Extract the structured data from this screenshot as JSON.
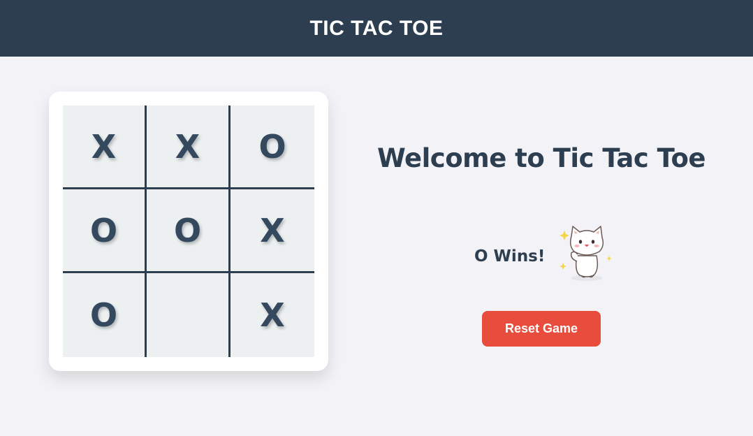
{
  "header": {
    "title": "TIC TAC TOE"
  },
  "board": {
    "cells": [
      "X",
      "X",
      "O",
      "O",
      "O",
      "X",
      "O",
      "",
      "X"
    ]
  },
  "main": {
    "welcome": "Welcome to Tic Tac Toe",
    "status": "O Wins!",
    "status_image": "happy-cat-sticker",
    "reset_label": "Reset Game"
  },
  "colors": {
    "header_bg": "#2d3e50",
    "page_bg": "#f3f3f7",
    "board_bg": "#ecf0f1",
    "mark": "#34495e",
    "grid_line": "#2c3e50",
    "reset_bg": "#e74c3c"
  }
}
